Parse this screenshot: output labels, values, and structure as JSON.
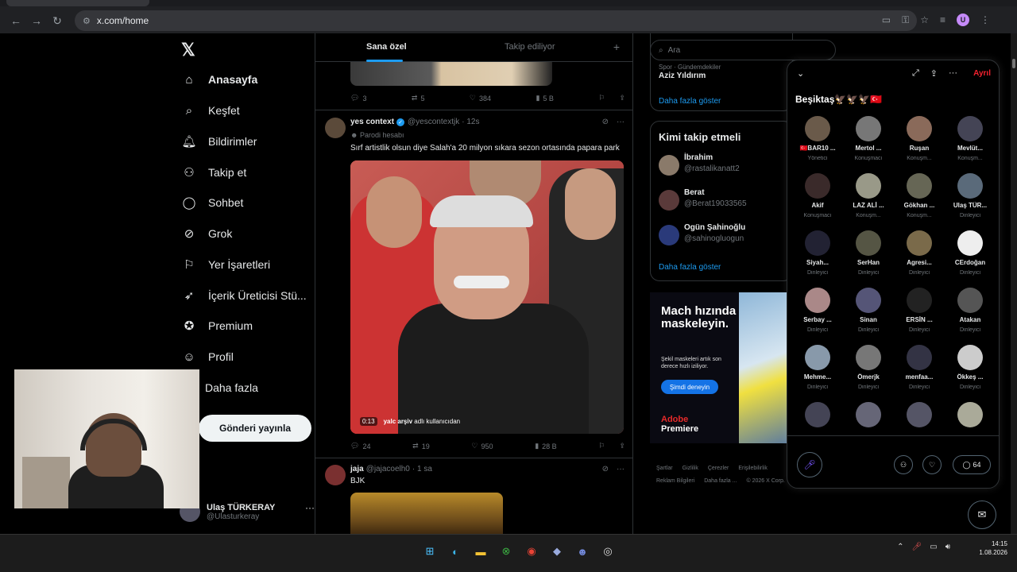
{
  "browser": {
    "url": "x.com/home",
    "profile_initial": "U"
  },
  "nav": {
    "items": [
      {
        "label": "Anasayfa",
        "icon": "home-icon"
      },
      {
        "label": "Keşfet",
        "icon": "search-icon"
      },
      {
        "label": "Bildirimler",
        "icon": "bell-icon"
      },
      {
        "label": "Takip et",
        "icon": "add-user-icon"
      },
      {
        "label": "Sohbet",
        "icon": "chat-icon"
      },
      {
        "label": "Grok",
        "icon": "grok-icon"
      },
      {
        "label": "Yer İşaretleri",
        "icon": "bookmark-icon"
      },
      {
        "label": "İçerik Üreticisi Stü...",
        "icon": "rocket-icon"
      },
      {
        "label": "Premium",
        "icon": "premium-icon"
      },
      {
        "label": "Profil",
        "icon": "profile-icon"
      },
      {
        "label": "Daha fazla",
        "icon": "more-icon"
      }
    ],
    "post_button": "Gönderi yayınla",
    "user_name": "Ulaş TÜRKERAY",
    "user_handle": "@Ulasturkeray"
  },
  "feed": {
    "tabs": [
      "Sana özel",
      "Takip ediliyor"
    ],
    "prev_tweet_actions": {
      "replies": "3",
      "retweets": "5",
      "likes": "384",
      "views": "5 B"
    },
    "tweet1": {
      "name": "yes context",
      "handle": "@yescontextjk",
      "time": "· 12s",
      "parody": "Parodi hesabı",
      "text": "Sırf artistlik olsun diye Salah'a 20 milyon sıkara sezon ortasında papara park",
      "video_time": "0:13",
      "video_user": "yalc arşiv",
      "video_caption": "adlı kullanıcıdan",
      "actions": {
        "replies": "24",
        "retweets": "19",
        "likes": "950",
        "views": "28 B"
      }
    },
    "tweet2": {
      "name": "jaja",
      "handle": "@jajacoelh0",
      "time": "· 1 sa",
      "text": "BJK"
    }
  },
  "right": {
    "search_placeholder": "Ara",
    "trend_category": "Spor · Gündemdekiler",
    "trend": "Aziz Yıldırım",
    "show_more": "Daha fazla göster",
    "who_to_follow_title": "Kimi takip etmeli",
    "who_to_follow": [
      {
        "name": "İbrahim",
        "handle": "@rastalikanatt2"
      },
      {
        "name": "Berat",
        "handle": "@Berat19033565"
      },
      {
        "name": "Ogün Şahinoğlu",
        "handle": "@sahinogluogun"
      }
    ],
    "ad": {
      "headline": "Mach hızında maskeleyin.",
      "sub": "Şekil maskeleri artık son derece hızlı iziliyor.",
      "cta": "Şimdi deneyin",
      "brand_red": "Adobe",
      "brand": "Premiere"
    },
    "footer": [
      "Şartlar",
      "Gizlilik",
      "Çerezler",
      "Erişilebilirlik",
      "Reklam Bilgileri",
      "Daha fazla ...",
      "© 2026 X Corp."
    ]
  },
  "space": {
    "title": "Beşiktaş🦅🦅🦅🇹🇷",
    "leave": "Ayrıl",
    "comment_count": "64",
    "participants": [
      {
        "name": "🇹🇷BAR10 ...",
        "role": "Yönetici"
      },
      {
        "name": "Mertol ...",
        "role": "Konuşmacı"
      },
      {
        "name": "Ruşan",
        "role": "Konuşm..."
      },
      {
        "name": "Mevlüt...",
        "role": "Konuşm..."
      },
      {
        "name": "Akif",
        "role": "Konuşmacı"
      },
      {
        "name": "LAZ ALİ ...",
        "role": "Konuşm..."
      },
      {
        "name": "Gökhan ...",
        "role": "Konuşm..."
      },
      {
        "name": "Ulaş TÜR...",
        "role": "Dinleyici"
      },
      {
        "name": "Siyah...",
        "role": "Dinleyici"
      },
      {
        "name": "SerHan",
        "role": "Dinleyici"
      },
      {
        "name": "Agresi...",
        "role": "Dinleyici"
      },
      {
        "name": "CErdoğan",
        "role": "Dinleyici"
      },
      {
        "name": "Serbay ...",
        "role": "Dinleyici"
      },
      {
        "name": "Sinan",
        "role": "Dinleyici"
      },
      {
        "name": "ERSİN ...",
        "role": "Dinleyici"
      },
      {
        "name": "Atakan",
        "role": "Dinleyici"
      },
      {
        "name": "Mehme...",
        "role": "Dinleyici"
      },
      {
        "name": "Ömerjk",
        "role": "Dinleyici"
      },
      {
        "name": "menfaa...",
        "role": "Dinleyici"
      },
      {
        "name": "Ökkeş ...",
        "role": "Dinleyici"
      },
      {
        "name": "",
        "role": ""
      },
      {
        "name": "",
        "role": ""
      },
      {
        "name": "",
        "role": ""
      },
      {
        "name": "",
        "role": ""
      }
    ]
  },
  "taskbar": {
    "time": "14:15",
    "date": "1.08.2026"
  }
}
